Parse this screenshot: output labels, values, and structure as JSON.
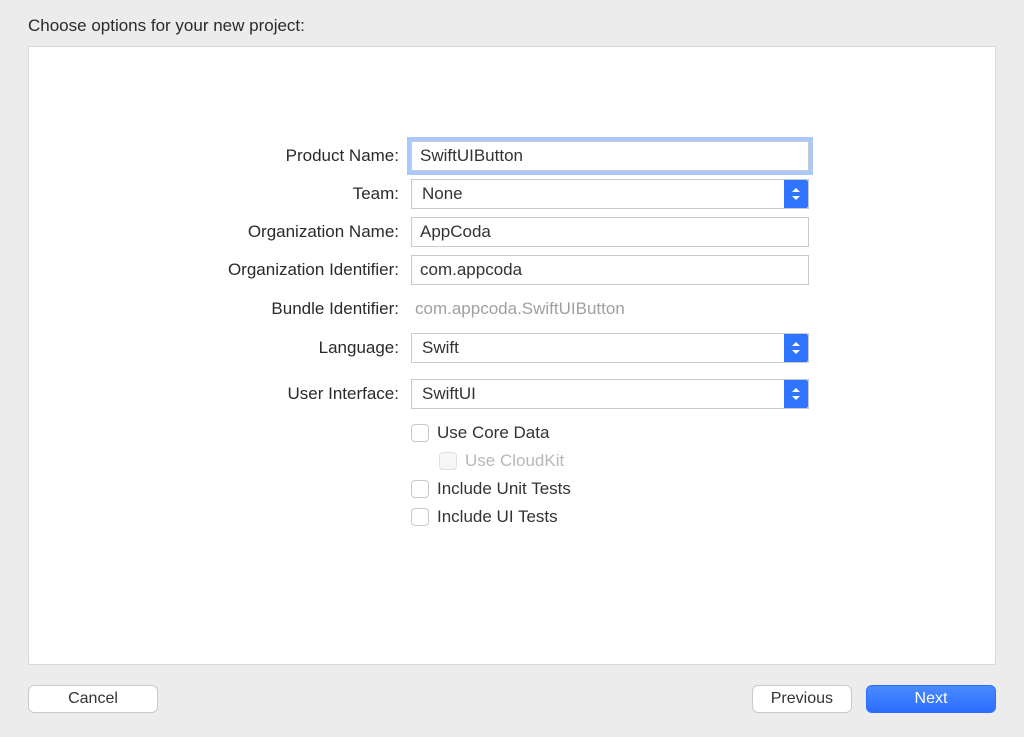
{
  "header": {
    "title": "Choose options for your new project:"
  },
  "form": {
    "product_name": {
      "label": "Product Name:",
      "value": "SwiftUIButton"
    },
    "team": {
      "label": "Team:",
      "value": "None"
    },
    "organization_name": {
      "label": "Organization Name:",
      "value": "AppCoda"
    },
    "organization_identifier": {
      "label": "Organization Identifier:",
      "value": "com.appcoda"
    },
    "bundle_identifier": {
      "label": "Bundle Identifier:",
      "value": "com.appcoda.SwiftUIButton"
    },
    "language": {
      "label": "Language:",
      "value": "Swift"
    },
    "user_interface": {
      "label": "User Interface:",
      "value": "SwiftUI"
    },
    "checkboxes": {
      "core_data": "Use Core Data",
      "cloudkit": "Use CloudKit",
      "unit_tests": "Include Unit Tests",
      "ui_tests": "Include UI Tests"
    }
  },
  "footer": {
    "cancel": "Cancel",
    "previous": "Previous",
    "next": "Next"
  }
}
